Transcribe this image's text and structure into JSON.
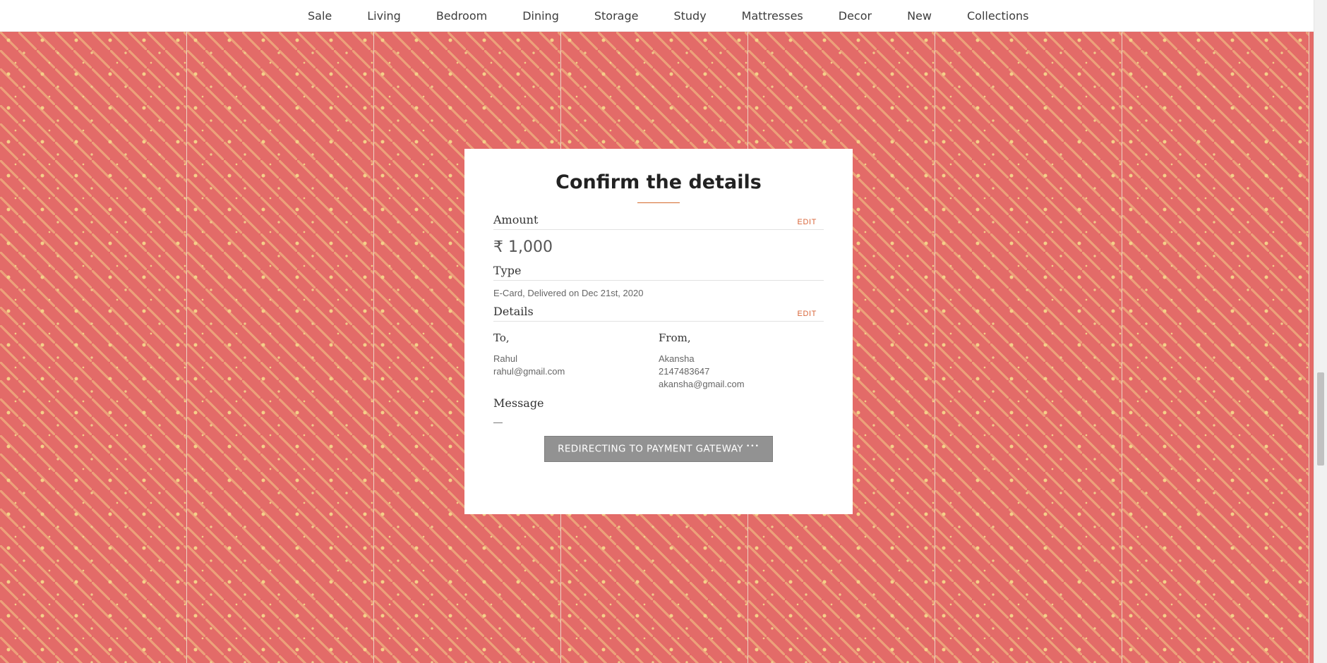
{
  "nav": {
    "items": [
      "Sale",
      "Living",
      "Bedroom",
      "Dining",
      "Storage",
      "Study",
      "Mattresses",
      "Decor",
      "New",
      "Collections"
    ]
  },
  "colors": {
    "background": "#e36b68",
    "pattern": "#f4d089",
    "accent": "#d9663a",
    "button": "#929292"
  },
  "confirm": {
    "title": "Confirm the details",
    "amount": {
      "label": "Amount",
      "edit_label": "EDIT",
      "value": "₹ 1,000"
    },
    "type": {
      "label": "Type",
      "value": "E-Card, Delivered on Dec 21st, 2020"
    },
    "details": {
      "label": "Details",
      "edit_label": "EDIT",
      "to": {
        "label": "To,",
        "name": "Rahul",
        "email": "rahul@gmail.com"
      },
      "from": {
        "label": "From,",
        "name": "Akansha",
        "phone": "2147483647",
        "email": "akansha@gmail.com"
      }
    },
    "message": {
      "label": "Message",
      "value": "—"
    },
    "button_label": "REDIRECTING TO PAYMENT GATEWAY",
    "button_dots": "•••"
  }
}
